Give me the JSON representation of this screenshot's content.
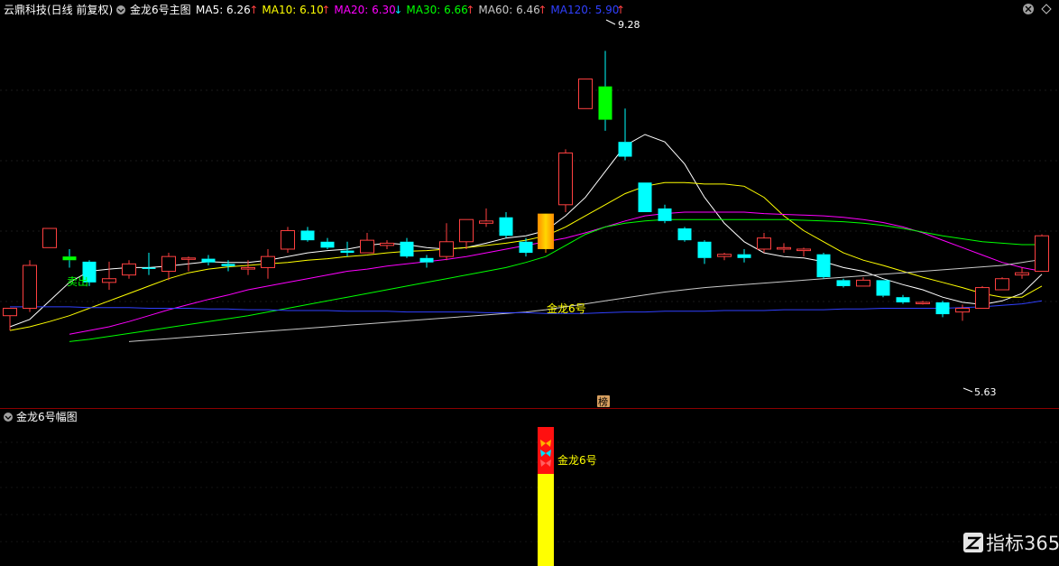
{
  "header": {
    "stock": "云鼎科技(日线 前复权)",
    "main_title": "金龙6号主图",
    "ma": [
      {
        "label": "MA5: 6.26",
        "arrow": "↑",
        "arrow_color": "#ff4040",
        "color": "#ffffff"
      },
      {
        "label": "MA10: 6.10",
        "arrow": "↑",
        "arrow_color": "#ff4040",
        "color": "#ffff00"
      },
      {
        "label": "MA20: 6.30",
        "arrow": "↓",
        "arrow_color": "#00e5ff",
        "color": "#ff00ff"
      },
      {
        "label": "MA30: 6.66",
        "arrow": "↑",
        "arrow_color": "#ff4040",
        "color": "#00ff00"
      },
      {
        "label": "MA60: 6.46",
        "arrow": "↑",
        "arrow_color": "#ff4040",
        "color": "#c8c8c8"
      },
      {
        "label": "MA120: 5.90",
        "arrow": "↑",
        "arrow_color": "#ff4040",
        "color": "#3040ff"
      }
    ]
  },
  "sub_panel": {
    "title": "金龙6号幅图",
    "signal_label": "金龙6号"
  },
  "watermark": "指标365",
  "colors": {
    "up": "#ff4040",
    "down": "#00ffff",
    "signal": "#ffd700",
    "sell": "#00ff00",
    "bg": "#000000"
  },
  "chart_data": {
    "type": "candlestick",
    "price_range": [
      4.5,
      9.7
    ],
    "annotations": {
      "high": "9.28",
      "low": "5.63",
      "sell": "卖出",
      "signal": "金龙6号",
      "rank_badge": "榜"
    },
    "candles": [
      {
        "o": 5.7,
        "h": 5.8,
        "l": 5.5,
        "c": 5.8,
        "color": "up"
      },
      {
        "o": 5.8,
        "h": 6.45,
        "l": 5.75,
        "c": 6.38,
        "color": "up"
      },
      {
        "o": 6.62,
        "h": 6.88,
        "l": 6.62,
        "c": 6.88,
        "color": "up"
      },
      {
        "o": 6.5,
        "h": 6.6,
        "l": 6.35,
        "c": 6.45,
        "color": "sell"
      },
      {
        "o": 6.43,
        "h": 6.45,
        "l": 6.1,
        "c": 6.15,
        "color": "down"
      },
      {
        "o": 6.15,
        "h": 6.43,
        "l": 6.05,
        "c": 6.2,
        "color": "up"
      },
      {
        "o": 6.25,
        "h": 6.45,
        "l": 6.2,
        "c": 6.4,
        "color": "up"
      },
      {
        "o": 6.35,
        "h": 6.55,
        "l": 6.25,
        "c": 6.35,
        "color": "down"
      },
      {
        "o": 6.3,
        "h": 6.55,
        "l": 6.18,
        "c": 6.5,
        "color": "up"
      },
      {
        "o": 6.48,
        "h": 6.5,
        "l": 6.3,
        "c": 6.48,
        "color": "up"
      },
      {
        "o": 6.47,
        "h": 6.52,
        "l": 6.38,
        "c": 6.42,
        "color": "down"
      },
      {
        "o": 6.4,
        "h": 6.45,
        "l": 6.3,
        "c": 6.37,
        "color": "down"
      },
      {
        "o": 6.33,
        "h": 6.45,
        "l": 6.25,
        "c": 6.35,
        "color": "up"
      },
      {
        "o": 6.35,
        "h": 6.6,
        "l": 6.2,
        "c": 6.5,
        "color": "up"
      },
      {
        "o": 6.6,
        "h": 6.9,
        "l": 6.55,
        "c": 6.85,
        "color": "up"
      },
      {
        "o": 6.85,
        "h": 6.9,
        "l": 6.7,
        "c": 6.72,
        "color": "down"
      },
      {
        "o": 6.7,
        "h": 6.75,
        "l": 6.6,
        "c": 6.62,
        "color": "down"
      },
      {
        "o": 6.58,
        "h": 6.7,
        "l": 6.5,
        "c": 6.55,
        "color": "down"
      },
      {
        "o": 6.55,
        "h": 6.82,
        "l": 6.55,
        "c": 6.72,
        "color": "up"
      },
      {
        "o": 6.68,
        "h": 6.72,
        "l": 6.6,
        "c": 6.65,
        "color": "up"
      },
      {
        "o": 6.7,
        "h": 6.75,
        "l": 6.48,
        "c": 6.5,
        "color": "down"
      },
      {
        "o": 6.48,
        "h": 6.52,
        "l": 6.35,
        "c": 6.42,
        "color": "down"
      },
      {
        "o": 6.5,
        "h": 6.95,
        "l": 6.45,
        "c": 6.7,
        "color": "up"
      },
      {
        "o": 6.7,
        "h": 7.0,
        "l": 6.6,
        "c": 7.0,
        "color": "up"
      },
      {
        "o": 6.95,
        "h": 7.15,
        "l": 6.9,
        "c": 6.98,
        "color": "up"
      },
      {
        "o": 7.03,
        "h": 7.1,
        "l": 6.75,
        "c": 6.78,
        "color": "down"
      },
      {
        "o": 6.7,
        "h": 6.75,
        "l": 6.5,
        "c": 6.55,
        "color": "down"
      },
      {
        "o": 6.6,
        "h": 7.08,
        "l": 6.55,
        "c": 7.08,
        "color": "signal"
      },
      {
        "o": 7.2,
        "h": 7.95,
        "l": 7.1,
        "c": 7.9,
        "color": "up"
      },
      {
        "o": 8.5,
        "h": 8.9,
        "l": 8.5,
        "c": 8.9,
        "color": "up"
      },
      {
        "o": 8.8,
        "h": 9.28,
        "l": 8.2,
        "c": 8.35,
        "color": "sell"
      },
      {
        "o": 8.05,
        "h": 8.5,
        "l": 7.8,
        "c": 7.85,
        "color": "down"
      },
      {
        "o": 7.5,
        "h": 7.5,
        "l": 7.1,
        "c": 7.1,
        "color": "down"
      },
      {
        "o": 7.15,
        "h": 7.2,
        "l": 6.95,
        "c": 6.98,
        "color": "down"
      },
      {
        "o": 6.88,
        "h": 6.9,
        "l": 6.7,
        "c": 6.72,
        "color": "down"
      },
      {
        "o": 6.7,
        "h": 6.72,
        "l": 6.4,
        "c": 6.48,
        "color": "down"
      },
      {
        "o": 6.53,
        "h": 6.55,
        "l": 6.45,
        "c": 6.5,
        "color": "up"
      },
      {
        "o": 6.53,
        "h": 6.6,
        "l": 6.42,
        "c": 6.48,
        "color": "down"
      },
      {
        "o": 6.6,
        "h": 6.82,
        "l": 6.55,
        "c": 6.75,
        "color": "up"
      },
      {
        "o": 6.6,
        "h": 6.68,
        "l": 6.55,
        "c": 6.62,
        "color": "up"
      },
      {
        "o": 6.6,
        "h": 6.62,
        "l": 6.5,
        "c": 6.58,
        "color": "up"
      },
      {
        "o": 6.53,
        "h": 6.55,
        "l": 6.2,
        "c": 6.22,
        "color": "down"
      },
      {
        "o": 6.18,
        "h": 6.2,
        "l": 6.08,
        "c": 6.1,
        "color": "down"
      },
      {
        "o": 6.1,
        "h": 6.22,
        "l": 6.1,
        "c": 6.18,
        "color": "up"
      },
      {
        "o": 6.18,
        "h": 6.18,
        "l": 5.95,
        "c": 5.97,
        "color": "down"
      },
      {
        "o": 5.95,
        "h": 5.98,
        "l": 5.86,
        "c": 5.88,
        "color": "down"
      },
      {
        "o": 5.88,
        "h": 5.9,
        "l": 5.85,
        "c": 5.88,
        "color": "up"
      },
      {
        "o": 5.88,
        "h": 5.9,
        "l": 5.68,
        "c": 5.72,
        "color": "down"
      },
      {
        "o": 5.75,
        "h": 5.85,
        "l": 5.63,
        "c": 5.8,
        "color": "up"
      },
      {
        "o": 5.8,
        "h": 6.1,
        "l": 5.8,
        "c": 6.08,
        "color": "up"
      },
      {
        "o": 6.05,
        "h": 6.22,
        "l": 6.05,
        "c": 6.2,
        "color": "up"
      },
      {
        "o": 6.25,
        "h": 6.35,
        "l": 6.2,
        "c": 6.28,
        "color": "up"
      },
      {
        "o": 6.3,
        "h": 6.8,
        "l": 6.3,
        "c": 6.78,
        "color": "up"
      }
    ],
    "ma_lines": {
      "MA5": [
        5.55,
        5.65,
        5.9,
        6.15,
        6.3,
        6.33,
        6.35,
        6.35,
        6.37,
        6.4,
        6.43,
        6.42,
        6.42,
        6.45,
        6.5,
        6.55,
        6.58,
        6.6,
        6.65,
        6.68,
        6.66,
        6.62,
        6.6,
        6.62,
        6.68,
        6.75,
        6.78,
        6.85,
        7.05,
        7.3,
        7.65,
        8.0,
        8.15,
        8.05,
        7.75,
        7.3,
        6.95,
        6.7,
        6.55,
        6.5,
        6.48,
        6.43,
        6.35,
        6.3,
        6.2,
        6.12,
        6.05,
        5.95,
        5.88,
        5.85,
        5.9,
        6.0,
        6.26
      ],
      "MA10": [
        5.5,
        5.55,
        5.62,
        5.7,
        5.8,
        5.9,
        6.0,
        6.1,
        6.2,
        6.28,
        6.33,
        6.36,
        6.38,
        6.4,
        6.42,
        6.45,
        6.47,
        6.5,
        6.52,
        6.55,
        6.57,
        6.58,
        6.6,
        6.62,
        6.65,
        6.68,
        6.72,
        6.78,
        6.9,
        7.05,
        7.2,
        7.35,
        7.45,
        7.5,
        7.5,
        7.48,
        7.48,
        7.45,
        7.3,
        7.05,
        6.85,
        6.7,
        6.55,
        6.45,
        6.38,
        6.3,
        6.22,
        6.15,
        6.08,
        6.0,
        5.95,
        5.95,
        6.1
      ],
      "MA20": [
        null,
        null,
        null,
        5.45,
        5.5,
        5.55,
        5.62,
        5.7,
        5.78,
        5.85,
        5.92,
        5.98,
        6.05,
        6.1,
        6.15,
        6.2,
        6.25,
        6.3,
        6.33,
        6.37,
        6.4,
        6.43,
        6.46,
        6.5,
        6.55,
        6.6,
        6.65,
        6.7,
        6.75,
        6.82,
        6.9,
        6.98,
        7.05,
        7.08,
        7.1,
        7.1,
        7.1,
        7.1,
        7.08,
        7.07,
        7.06,
        7.05,
        7.03,
        7.0,
        6.96,
        6.9,
        6.82,
        6.72,
        6.62,
        6.52,
        6.42,
        6.35,
        6.3
      ],
      "MA30": [
        null,
        null,
        null,
        5.35,
        5.38,
        5.42,
        5.46,
        5.5,
        5.54,
        5.58,
        5.62,
        5.66,
        5.7,
        5.75,
        5.8,
        5.85,
        5.9,
        5.95,
        6.0,
        6.05,
        6.1,
        6.15,
        6.2,
        6.25,
        6.3,
        6.35,
        6.42,
        6.5,
        6.65,
        6.8,
        6.9,
        6.95,
        6.98,
        7.0,
        7.0,
        7.0,
        7.0,
        7.0,
        7.0,
        7.0,
        6.99,
        6.98,
        6.97,
        6.95,
        6.92,
        6.88,
        6.83,
        6.78,
        6.74,
        6.7,
        6.68,
        6.66,
        6.66
      ],
      "MA60": [
        null,
        null,
        null,
        null,
        null,
        null,
        5.35,
        5.37,
        5.39,
        5.41,
        5.43,
        5.45,
        5.47,
        5.49,
        5.51,
        5.53,
        5.55,
        5.57,
        5.59,
        5.61,
        5.63,
        5.65,
        5.67,
        5.69,
        5.71,
        5.73,
        5.75,
        5.78,
        5.82,
        5.86,
        5.9,
        5.94,
        5.98,
        6.02,
        6.05,
        6.08,
        6.1,
        6.12,
        6.14,
        6.16,
        6.18,
        6.2,
        6.22,
        6.24,
        6.26,
        6.28,
        6.3,
        6.32,
        6.34,
        6.36,
        6.38,
        6.42,
        6.46
      ],
      "MA120": [
        5.82,
        5.82,
        5.82,
        5.82,
        5.81,
        5.81,
        5.81,
        5.8,
        5.8,
        5.8,
        5.79,
        5.79,
        5.78,
        5.78,
        5.77,
        5.77,
        5.77,
        5.76,
        5.76,
        5.76,
        5.75,
        5.75,
        5.75,
        5.75,
        5.74,
        5.74,
        5.74,
        5.73,
        5.73,
        5.73,
        5.74,
        5.75,
        5.75,
        5.76,
        5.76,
        5.76,
        5.77,
        5.77,
        5.77,
        5.78,
        5.78,
        5.78,
        5.79,
        5.79,
        5.8,
        5.8,
        5.8,
        5.8,
        5.81,
        5.82,
        5.84,
        5.86,
        5.9
      ]
    },
    "sub_bar_index": 27
  }
}
